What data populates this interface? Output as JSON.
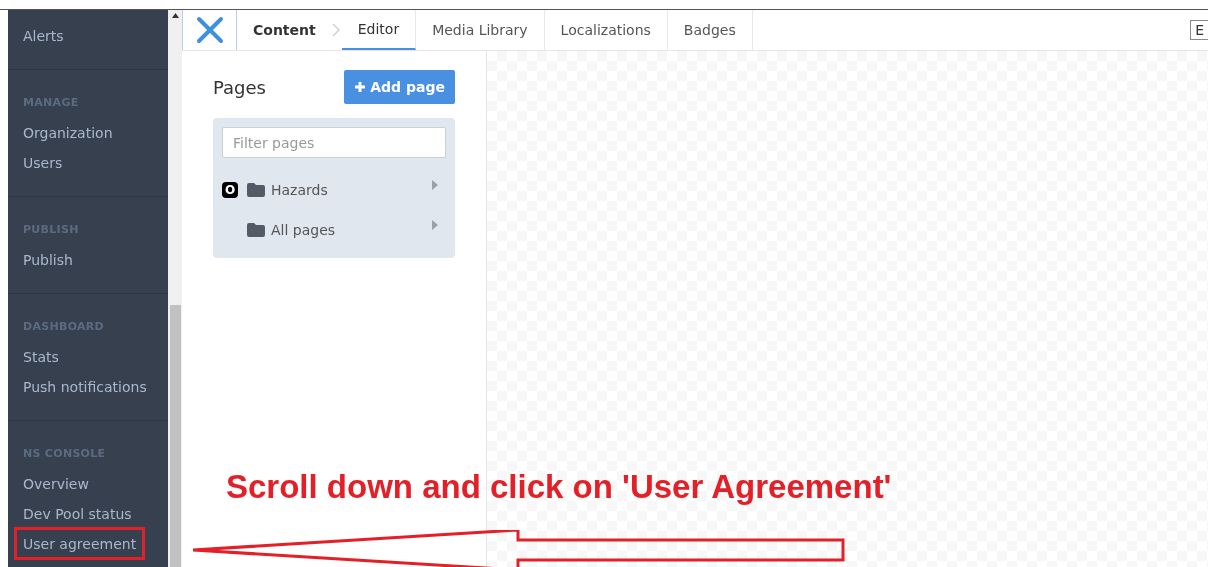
{
  "sidebar": {
    "sections": [
      {
        "items": [
          {
            "label": "Alerts",
            "highlighted": false
          }
        ]
      },
      {
        "title": "MANAGE",
        "items": [
          {
            "label": "Organization",
            "highlighted": false
          },
          {
            "label": "Users",
            "highlighted": false
          }
        ]
      },
      {
        "title": "PUBLISH",
        "items": [
          {
            "label": "Publish",
            "highlighted": false
          }
        ]
      },
      {
        "title": "DASHBOARD",
        "items": [
          {
            "label": "Stats",
            "highlighted": false
          },
          {
            "label": "Push notifications",
            "highlighted": false
          }
        ]
      },
      {
        "title": "NS CONSOLE",
        "items": [
          {
            "label": "Overview",
            "highlighted": false
          },
          {
            "label": "Dev Pool status",
            "highlighted": false
          },
          {
            "label": "User agreement",
            "highlighted": true
          }
        ]
      }
    ]
  },
  "tabs": [
    {
      "label": "Content",
      "kind": "breadcrumb",
      "selected": false
    },
    {
      "label": "Editor",
      "kind": "tab",
      "selected": true
    },
    {
      "label": "Media Library",
      "kind": "tab",
      "selected": false
    },
    {
      "label": "Localizations",
      "kind": "tab",
      "selected": false
    },
    {
      "label": "Badges",
      "kind": "tab",
      "selected": false
    }
  ],
  "top_right_field": {
    "value": "E"
  },
  "pages": {
    "title": "Pages",
    "add_button": "Add page",
    "filter": {
      "placeholder": "Filter pages"
    },
    "tree": [
      {
        "label": "Hazards",
        "badge": "O"
      },
      {
        "label": "All pages"
      }
    ]
  },
  "annotation": {
    "text": "Scroll down and click on 'User Agreement'"
  }
}
